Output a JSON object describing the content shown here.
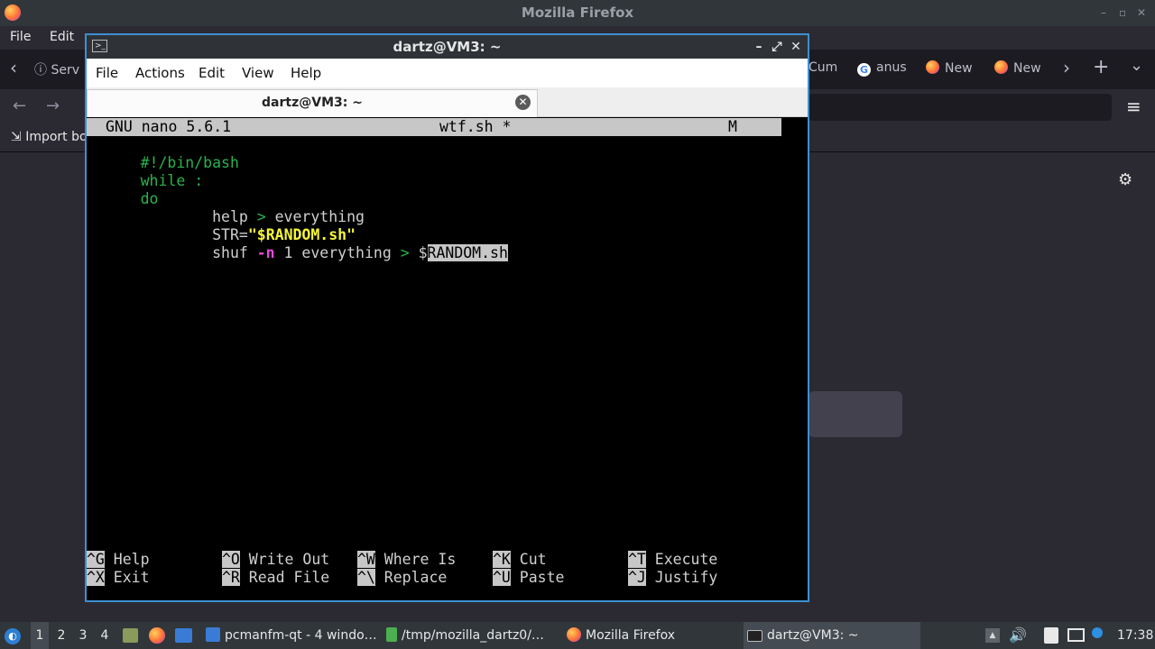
{
  "firefox": {
    "window_title": "Mozilla Firefox",
    "menu": [
      "File",
      "Edit"
    ],
    "tabs": [
      "Serv",
      "Cum",
      "anus",
      "New",
      "New"
    ],
    "bookmarks_label": "Import bo",
    "icons": {
      "back": "‹",
      "forward": "›",
      "new_tab": "+",
      "list_tabs": "⌄",
      "nav_back": "←",
      "nav_forward": "→",
      "menu": "≡",
      "settings": "⚙",
      "info": "ⓘ",
      "import": "⇲",
      "minimize": "–",
      "maximize": "▫",
      "close": "✕"
    }
  },
  "terminal": {
    "title": "dartz@VM3: ~",
    "menu": [
      "File",
      "Actions",
      "Edit",
      "View",
      "Help"
    ],
    "tab_label": "dartz@VM3: ~",
    "icons": {
      "terminal": ">_",
      "minimize": "–",
      "maximize": "⤢",
      "close": "✕",
      "tab_close": "✕"
    }
  },
  "nano": {
    "version": "GNU nano 5.6.1",
    "filename": "wtf.sh *",
    "modified_flag": "M",
    "code": {
      "shebang": "#!/bin/bash",
      "while_kw": "while",
      "while_rest": " :",
      "do_kw": "do",
      "l4_indent": "        help ",
      "l4_op": ">",
      "l4_rest": " everything",
      "l5_indent": "        STR=",
      "l5_str": "\"$RANDOM.sh\"",
      "l6_indent": "        shuf ",
      "l6_flag": "-n",
      "l6_mid": " 1 everything ",
      "l6_op": ">",
      "l6_space": " ",
      "l6_dollar": "$",
      "l6_sel": "RANDOM.sh"
    },
    "shortcuts": [
      {
        "key": "^G",
        "label": " Help"
      },
      {
        "key": "^O",
        "label": " Write Out"
      },
      {
        "key": "^W",
        "label": " Where Is"
      },
      {
        "key": "^K",
        "label": " Cut"
      },
      {
        "key": "^T",
        "label": " Execute"
      },
      {
        "key": "^X",
        "label": " Exit"
      },
      {
        "key": "^R",
        "label": " Read File"
      },
      {
        "key": "^\\",
        "label": " Replace"
      },
      {
        "key": "^U",
        "label": " Paste"
      },
      {
        "key": "^J",
        "label": " Justify"
      }
    ]
  },
  "taskbar": {
    "workspaces": [
      "1",
      "2",
      "3",
      "4"
    ],
    "tasks": [
      "pcmanfm-qt - 4 windo…",
      "/tmp/mozilla_dartz0/…",
      "Mozilla Firefox",
      "dartz@VM3: ~"
    ],
    "clock": "17:38",
    "icons": {
      "start": "start-menu-icon",
      "volume": "🔊",
      "tray_up": "▲"
    }
  },
  "colors": {
    "accent": "#3d8fd1",
    "nano_green": "#2bb24c",
    "nano_yellow": "#f5f53a",
    "nano_magenta": "#e04ad8",
    "nano_bar": "#c7c7c7"
  }
}
